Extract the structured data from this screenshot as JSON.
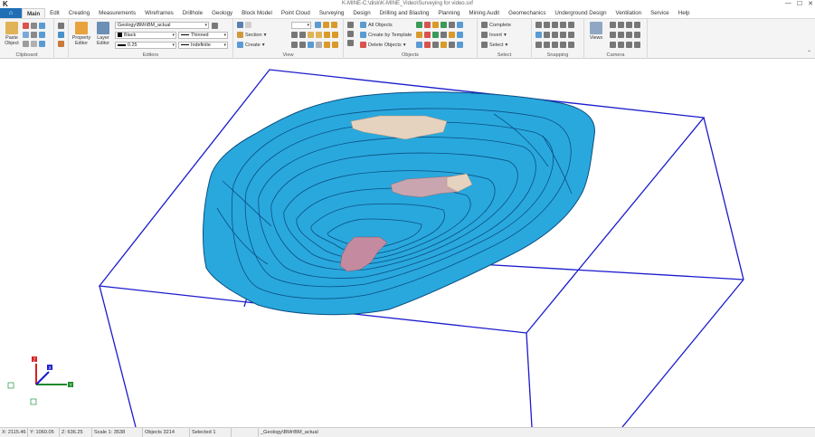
{
  "app": {
    "logo": "K",
    "title": "K-MINE-C:\\disk\\K-MINE_Video\\Surveying for video.sxf",
    "controls": {
      "minimize": "—",
      "maximize": "☐",
      "close": "✕"
    }
  },
  "tabs": [
    "Main",
    "Edit",
    "Creating",
    "Measurements",
    "Wireframes",
    "Drillhole",
    "Geology",
    "Block Model",
    "Point Cloud",
    "Surveying",
    "Design",
    "Drilling and Blasting",
    "Planning",
    "Mining Audit",
    "Geomechanics",
    "Underground Design",
    "Ventilation",
    "Service",
    "Help"
  ],
  "active_tab": "Main",
  "ribbon": {
    "clipboard": {
      "label": "Clipboard",
      "paste": "Paste Object"
    },
    "editors": {
      "label": "Editors",
      "property_editor": "Property Editor",
      "layer_editor": "Layer Editor",
      "layer_value": "Geology\\BMr\\BM_actual",
      "color_value": "Black",
      "linestyle_value": "Thinned",
      "lineweight_value": "0.25",
      "linetype_value": "Indefinite"
    },
    "view": {
      "label": "View",
      "section": "Section",
      "create": "Create"
    },
    "objects": {
      "label": "Objects",
      "all_objects": "All Objects",
      "create_by_template": "Create by Template",
      "delete_objects": "Delete Objects"
    },
    "select": {
      "label": "Select",
      "complete": "Complete",
      "invert": "Invert",
      "select": "Select"
    },
    "snapping": {
      "label": "Snapping"
    },
    "camera": {
      "label": "Camera",
      "views": "Views"
    }
  },
  "statusbar": {
    "x": "X: 2115.46",
    "y": "Y: 1060.05",
    "z": "Z: 636.25",
    "scale": "Scale 1: 3538",
    "objects": "Objects 3214",
    "selected": "Selected 1",
    "layer": "_Geology\\BMr\\BM_actual"
  },
  "colors": {
    "accent": "#1f6fb6",
    "model_fill": "#29a8de",
    "model_edge": "#0b4f80",
    "bounding_box": "#1a1acc",
    "ore_light": "#e6d3bf",
    "ore_pink": "#c48aa0"
  },
  "axes": {
    "x": "X",
    "y": "Y",
    "z": "Z"
  }
}
